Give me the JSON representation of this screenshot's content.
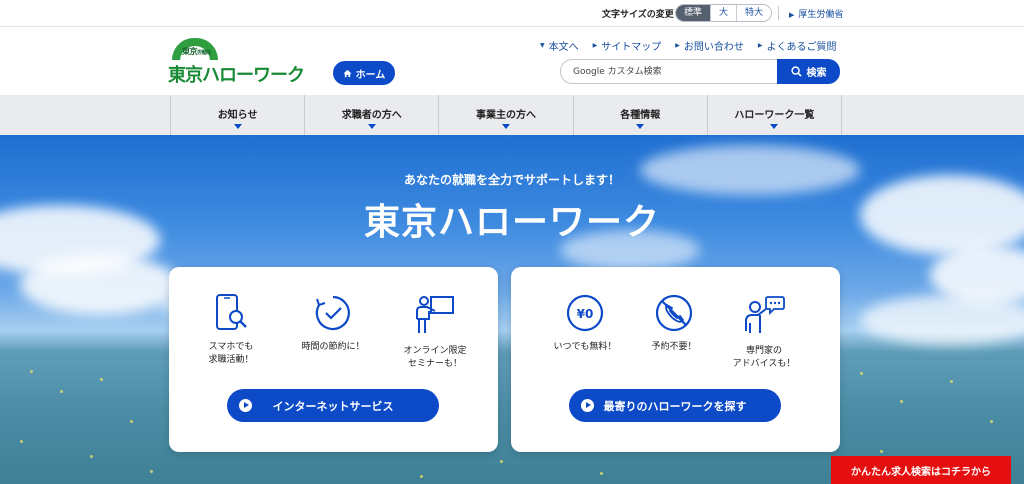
{
  "utility_bar": {
    "font_size_label": "文字サイズの変更",
    "font_sizes": [
      "標準",
      "大",
      "特大"
    ],
    "font_size_selected": "標準",
    "mhlw_link": "厚生労働省"
  },
  "header": {
    "logo_small": "東京",
    "logo_small_sub": "労働局",
    "logo_text": "東京ハローワーク",
    "home_button": "ホーム",
    "links": [
      "本文へ",
      "サイトマップ",
      "お問い合わせ",
      "よくあるご質問"
    ],
    "search_placeholder": "Google カスタム検索",
    "search_button": "検索"
  },
  "nav": {
    "items": [
      "お知らせ",
      "求職者の方へ",
      "事業主の方へ",
      "各種情報",
      "ハローワーク一覧"
    ]
  },
  "hero": {
    "tagline": "あなたの就職を全力でサポートします！",
    "title": "東京ハローワーク"
  },
  "card_left": {
    "features": [
      {
        "icon": "smartphone-search-icon",
        "label": "スマホでも\n求職活動！"
      },
      {
        "icon": "clock-check-icon",
        "label": "時間の節約に！"
      },
      {
        "icon": "presenter-board-icon",
        "label": "オンライン限定\nセミナーも！"
      }
    ],
    "button": "インターネットサービス"
  },
  "card_right": {
    "features": [
      {
        "icon": "yen-zero-icon",
        "label": "いつでも無料！"
      },
      {
        "icon": "no-phone-icon",
        "label": "予約不要！"
      },
      {
        "icon": "advisor-chat-icon",
        "label": "専門家の\nアドバイスも！"
      }
    ],
    "button": "最寄りのハローワークを探す"
  },
  "floating_banner": "かんたん求人検索はコチラから",
  "colors": {
    "primary": "#0c4ac8",
    "logo_green": "#178a35",
    "banner_red": "#e60f0f",
    "nav_bg": "#e9ebee"
  }
}
